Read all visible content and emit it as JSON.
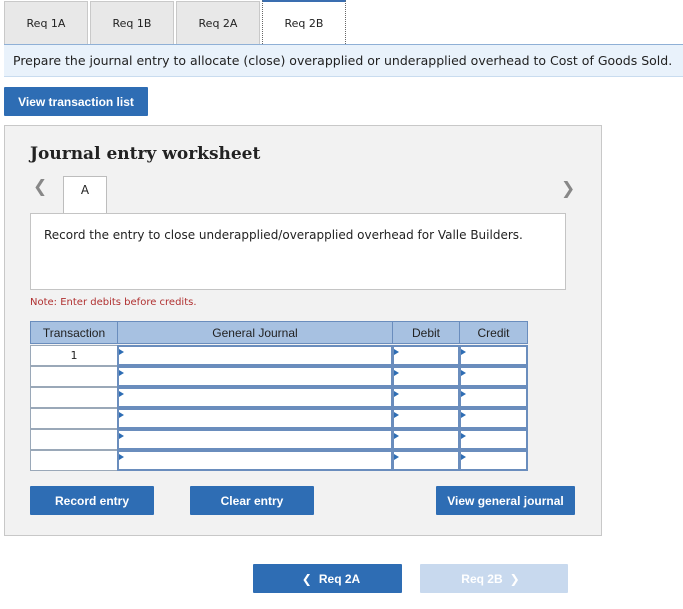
{
  "tabs": [
    {
      "label": "Req 1A",
      "active": false
    },
    {
      "label": "Req 1B",
      "active": false
    },
    {
      "label": "Req 2A",
      "active": false
    },
    {
      "label": "Req 2B",
      "active": true
    }
  ],
  "instruction": "Prepare the journal entry to allocate (close) overapplied or underapplied overhead to Cost of Goods Sold.",
  "view_transaction_list": "View transaction list",
  "worksheet": {
    "title": "Journal entry worksheet",
    "prev_icon": "chevron-left-icon",
    "next_icon": "chevron-right-icon",
    "subtab": "A",
    "description": "Record the entry to close underapplied/overapplied overhead for Valle Builders.",
    "note": "Note: Enter debits before credits.",
    "table": {
      "headers": {
        "transaction": "Transaction",
        "journal": "General Journal",
        "debit": "Debit",
        "credit": "Credit"
      },
      "rows": [
        {
          "transaction": "1",
          "account": "",
          "debit": "",
          "credit": ""
        },
        {
          "transaction": "",
          "account": "",
          "debit": "",
          "credit": ""
        },
        {
          "transaction": "",
          "account": "",
          "debit": "",
          "credit": ""
        },
        {
          "transaction": "",
          "account": "",
          "debit": "",
          "credit": ""
        },
        {
          "transaction": "",
          "account": "",
          "debit": "",
          "credit": ""
        },
        {
          "transaction": "",
          "account": "",
          "debit": "",
          "credit": ""
        }
      ]
    },
    "buttons": {
      "record": "Record entry",
      "clear": "Clear entry",
      "view_general_journal": "View general journal"
    }
  },
  "nav": {
    "prev_label": "Req 2A",
    "next_label": "Req 2B"
  },
  "colors": {
    "primary": "#2e6db4",
    "header": "#a7c1e1",
    "disabled": "#c8d9ee",
    "note": "#b03030"
  }
}
